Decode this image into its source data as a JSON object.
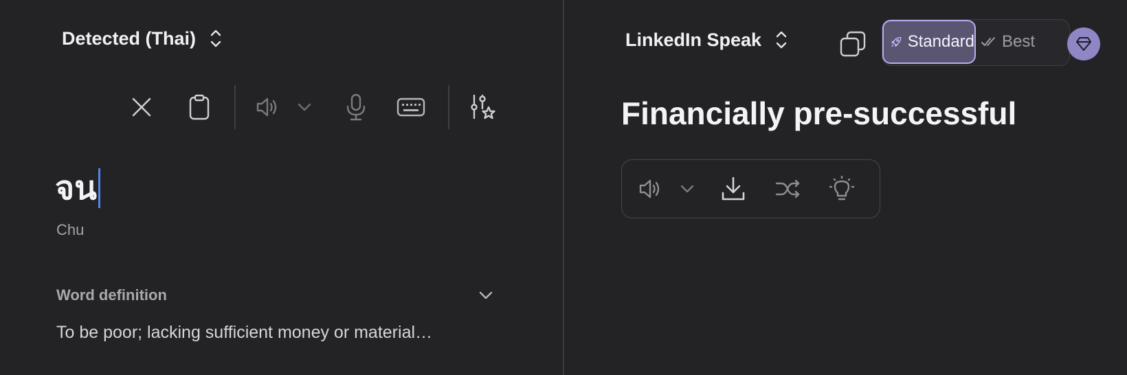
{
  "source": {
    "language_label": "Detected (Thai)",
    "text": "จน",
    "romanization": "Chu",
    "definition": {
      "title": "Word definition",
      "text": "To be poor; lacking sufficient money or material…"
    },
    "toolbar_icons": [
      "close-icon",
      "clipboard-icon",
      "speaker-icon",
      "chevron-down-icon",
      "microphone-icon",
      "keyboard-icon",
      "settings-sliders-star-icon"
    ]
  },
  "target": {
    "language_label": "LinkedIn Speak",
    "result": "Financially pre-successful",
    "modes": {
      "standard_label": "Standard",
      "best_label": "Best",
      "selected": "Standard"
    },
    "toolbar_icons": [
      "speaker-icon",
      "chevron-down-icon",
      "download-icon",
      "shuffle-icon",
      "lightbulb-icon"
    ]
  },
  "colors": {
    "background": "#232326",
    "accent": "#b6aef0",
    "caret": "#4f86e8",
    "premium": "#8f86c6"
  }
}
